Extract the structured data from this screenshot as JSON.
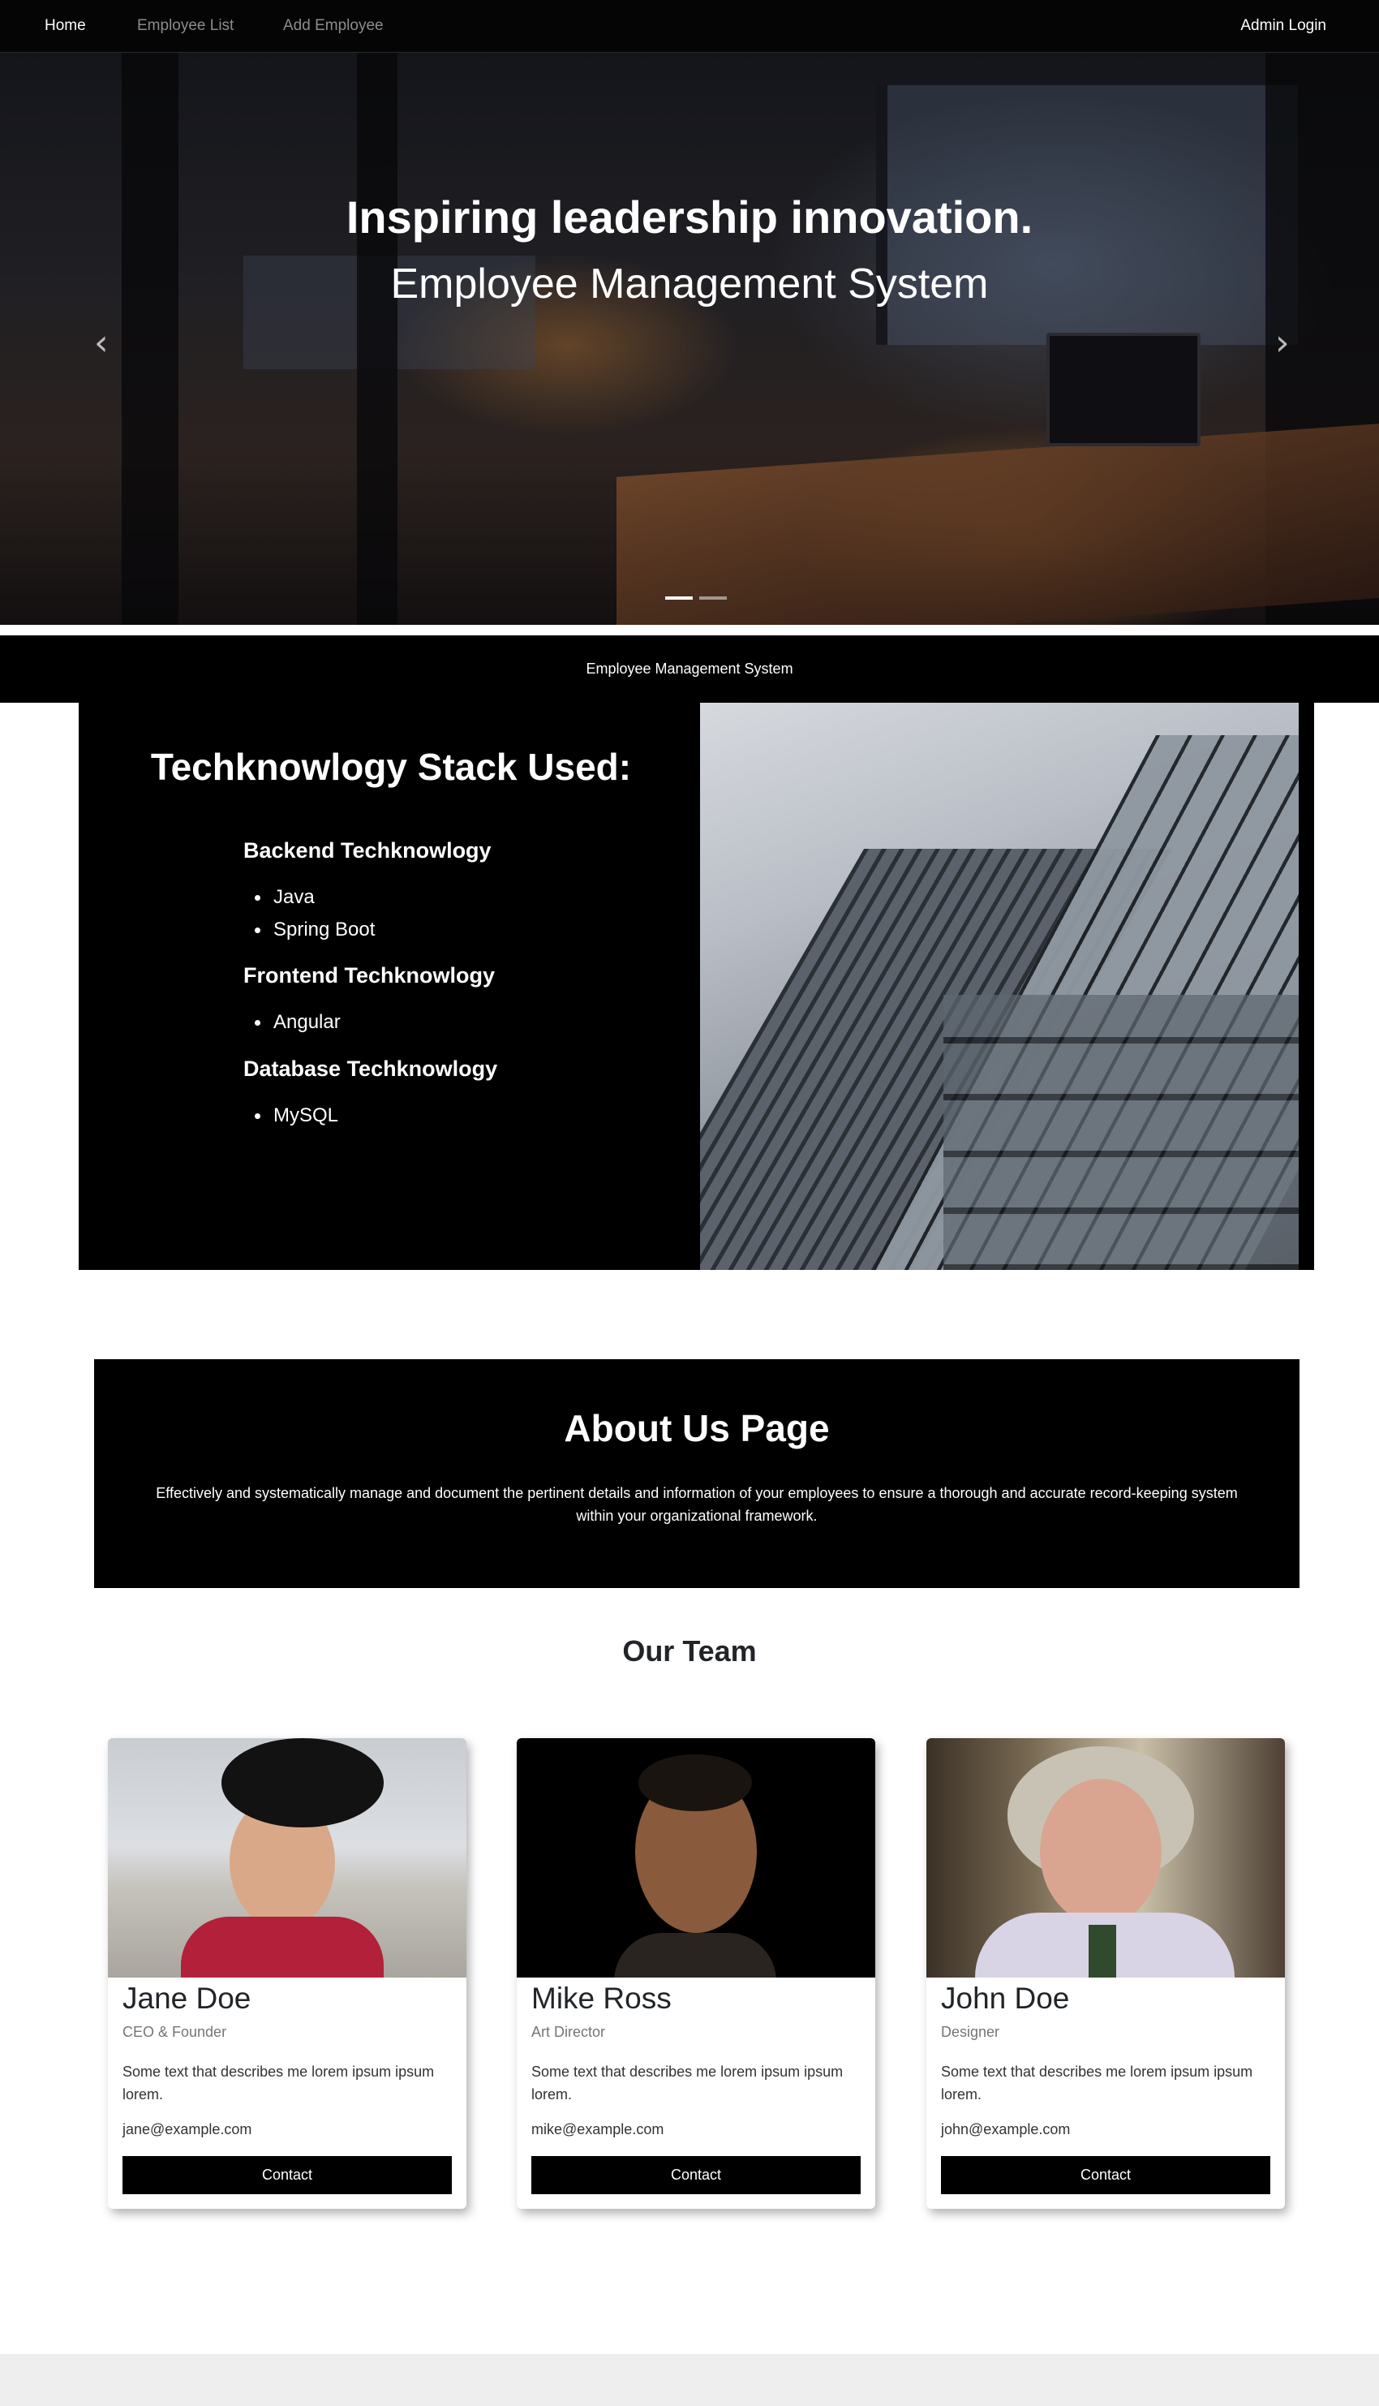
{
  "navbar": {
    "home": "Home",
    "employee_list": "Employee List",
    "add_employee": "Add Employee",
    "admin_login": "Admin Login"
  },
  "hero": {
    "title": "Inspiring leadership innovation.",
    "subtitle": "Employee Management System",
    "prev_icon": "‹",
    "next_icon": "›",
    "active_slide": 1,
    "slide_count": 2
  },
  "strip": {
    "text": "Employee Management System"
  },
  "tech": {
    "title": "Techknowlogy Stack Used:",
    "groups": [
      {
        "heading": "Backend Techknowlogy",
        "items": [
          "Java",
          "Spring Boot"
        ]
      },
      {
        "heading": "Frontend Techknowlogy",
        "items": [
          "Angular"
        ]
      },
      {
        "heading": "Database Techknowlogy",
        "items": [
          "MySQL"
        ]
      }
    ]
  },
  "about": {
    "title": "About Us Page",
    "text": "Effectively and systematically manage and document the pertinent details and information of your employees to ensure a thorough and accurate record-keeping system within your organizational framework."
  },
  "team": {
    "title": "Our Team",
    "members": [
      {
        "name": "Jane Doe",
        "role": "CEO & Founder",
        "description": "Some text that describes me lorem ipsum ipsum lorem.",
        "email": "jane@example.com",
        "button": "Contact"
      },
      {
        "name": "Mike Ross",
        "role": "Art Director",
        "description": "Some text that describes me lorem ipsum ipsum lorem.",
        "email": "mike@example.com",
        "button": "Contact"
      },
      {
        "name": "John Doe",
        "role": "Designer",
        "description": "Some text that describes me lorem ipsum ipsum lorem.",
        "email": "john@example.com",
        "button": "Contact"
      }
    ]
  },
  "colors": {
    "nav_background": "#050505",
    "section_black": "#000000",
    "nav_inactive": "#8c8c8c",
    "footer_background": "#eeeeee"
  }
}
